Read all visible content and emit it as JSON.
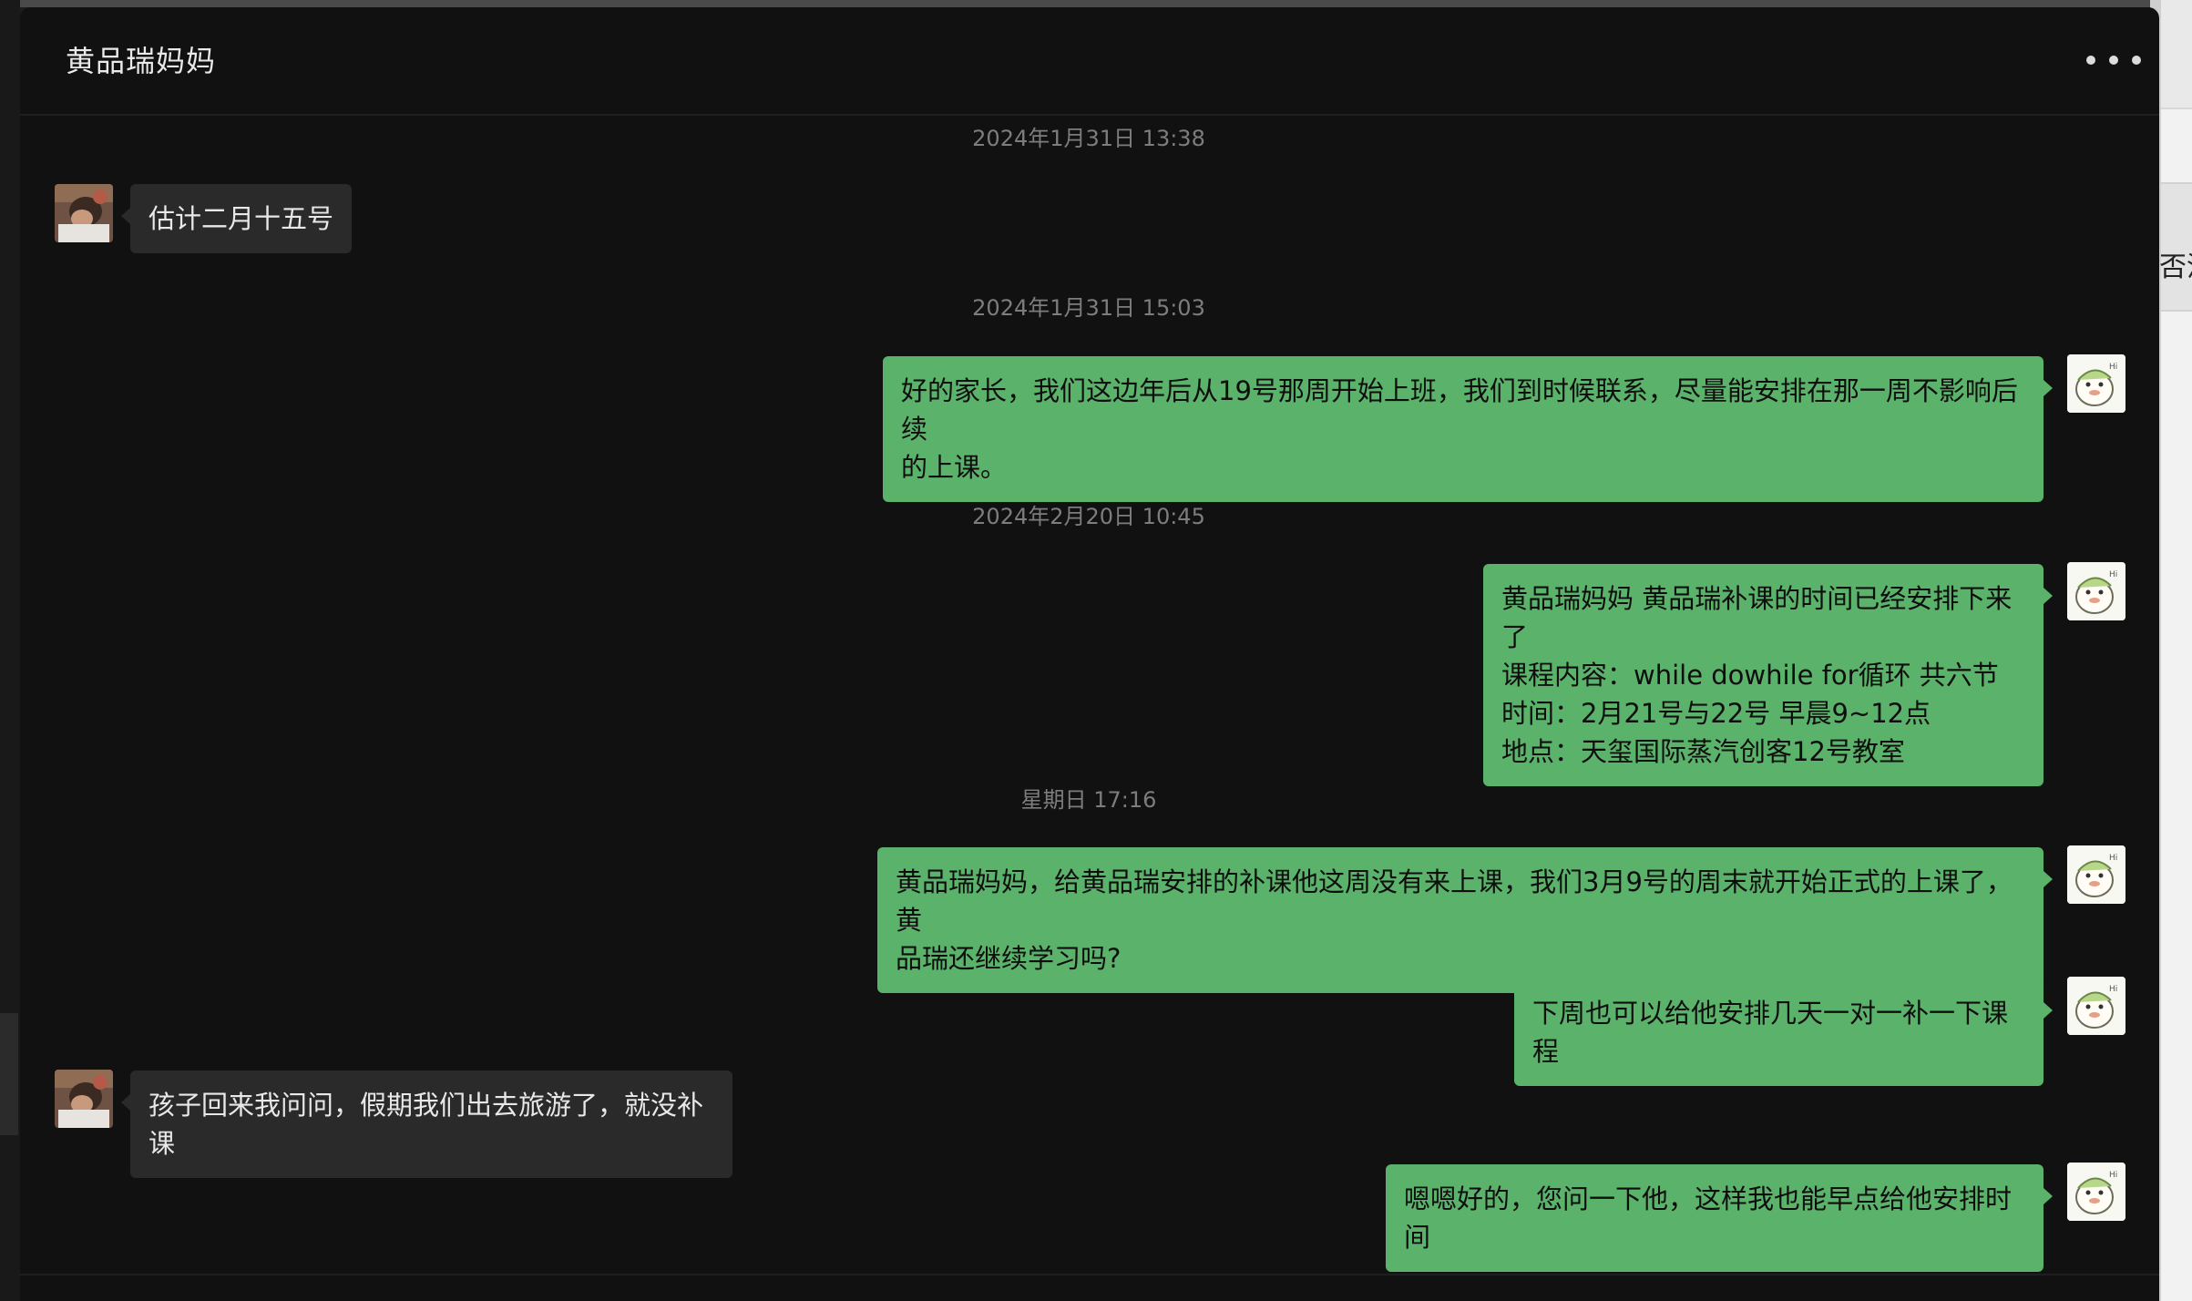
{
  "header": {
    "title": "黄品瑞妈妈",
    "more_icon": "more-dots-icon"
  },
  "right_peek_text": "否沟",
  "timestamps": [
    "2024年1月31日 13:38",
    "2024年1月31日 15:03",
    "2024年2月20日 10:45",
    "星期日 17:16"
  ],
  "messages": [
    {
      "from": "other",
      "text": "估计二月十五号"
    },
    {
      "from": "self",
      "text": "好的家长，我们这边年后从19号那周开始上班，我们到时候联系，尽量能安排在那一周不影响后续\n的上课。"
    },
    {
      "from": "self",
      "text": "黄品瑞妈妈 黄品瑞补课的时间已经安排下来了\n课程内容：while dowhile for循环 共六节\n时间：2月21号与22号 早晨9~12点\n地点：天玺国际蒸汽创客12号教室"
    },
    {
      "from": "self",
      "text": "黄品瑞妈妈，给黄品瑞安排的补课他这周没有来上课，我们3月9号的周末就开始正式的上课了，黄\n品瑞还继续学习吗?"
    },
    {
      "from": "self",
      "text": "下周也可以给他安排几天一对一补一下课程"
    },
    {
      "from": "other",
      "text": "孩子回来我问问，假期我们出去旅游了，就没补课"
    },
    {
      "from": "self",
      "text": "嗯嗯好的，您问一下他，这样我也能早点给他安排时间"
    }
  ],
  "colors": {
    "self_bubble": "#5bb26a",
    "other_bubble": "#2a2a2a",
    "background": "#111111"
  }
}
